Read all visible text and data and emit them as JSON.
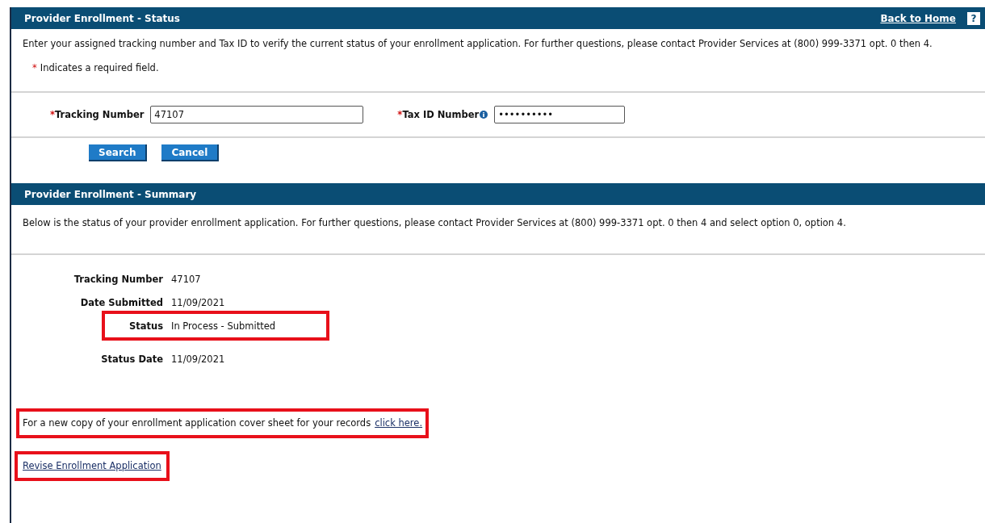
{
  "status_panel": {
    "title": "Provider Enrollment - Status",
    "back_link": "Back to Home",
    "help_icon": "?",
    "intro": "Enter your assigned tracking number and Tax ID to verify the current status of your enrollment application. For further questions, please contact Provider Services at (800) 999-3371 opt. 0 then 4.",
    "required_note": {
      "mark": "*",
      "text": "Indicates a required field."
    },
    "fields": [
      {
        "mark": "*",
        "label": "Tracking Number",
        "value": "47107",
        "info": false
      },
      {
        "mark": "*",
        "label": "Tax ID Number",
        "value": "••••••••••",
        "info": true
      }
    ],
    "buttons": [
      "Search",
      "Cancel"
    ]
  },
  "summary_panel": {
    "title": "Provider Enrollment - Summary",
    "intro": "Below is the status of your provider enrollment application. For further questions, please contact Provider Services at (800) 999-3371 opt. 0 then 4 and select option 0, option 4.",
    "details": [
      {
        "label": "Tracking Number",
        "value": "47107",
        "highlighted": false
      },
      {
        "label": "Date Submitted",
        "value": "11/09/2021",
        "highlighted": false
      },
      {
        "label": "Status",
        "value": "In Process - Submitted",
        "highlighted": true
      },
      {
        "label": "Status Date",
        "value": "11/09/2021",
        "highlighted": false
      }
    ],
    "cover_sheet": {
      "text": "For a new copy of your enrollment application cover sheet for your records",
      "link": "click here.",
      "highlighted": true
    },
    "revise_link": {
      "text": "Revise Enrollment Application",
      "highlighted": true
    }
  }
}
